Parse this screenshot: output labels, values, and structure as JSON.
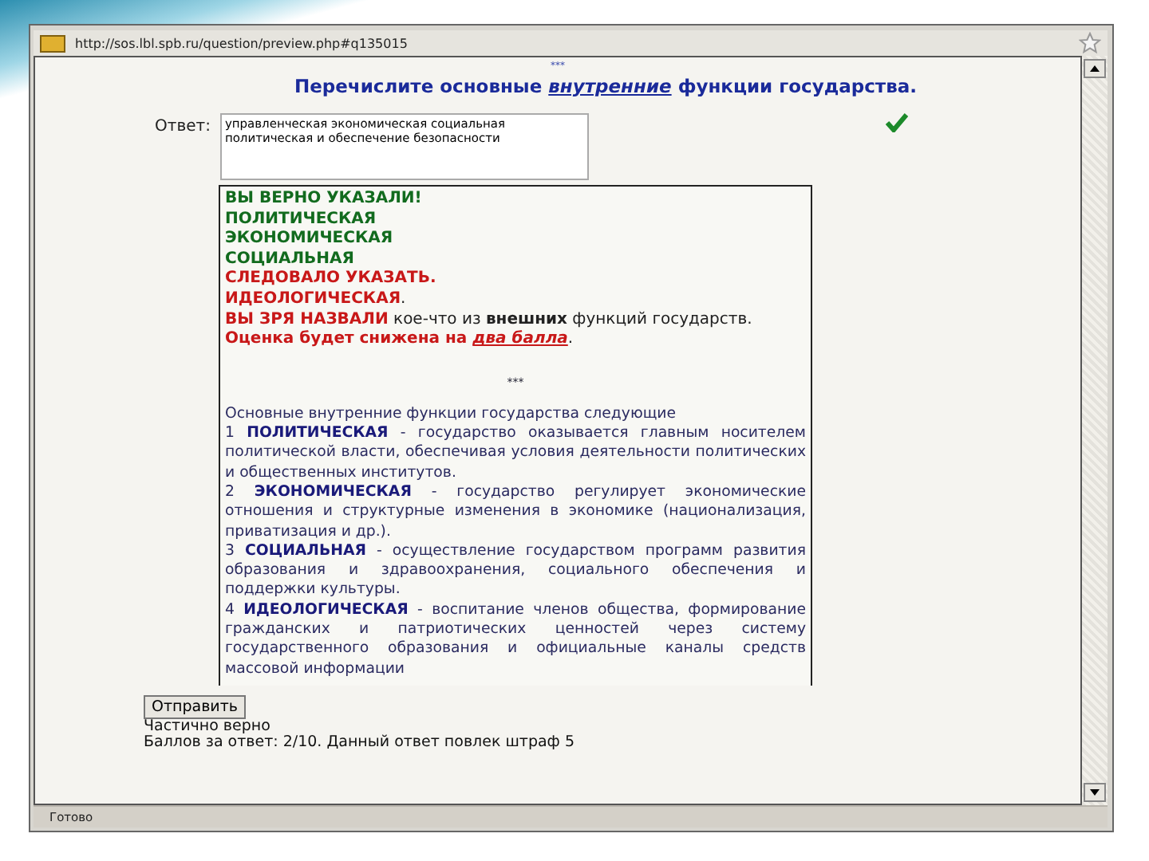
{
  "browser": {
    "address": "http://sos.lbl.spb.ru/question/preview.php#q135015",
    "status_bar": "Готово"
  },
  "question": {
    "mark": "***",
    "title_before": "Перечислите основные",
    "title_emphasis": "внутренние",
    "title_after": "функции государства."
  },
  "answer": {
    "label": "Ответ:",
    "value": "управленческая экономическая социальная\nполитическая и обеспечение безопасности",
    "correct": true
  },
  "feedback": {
    "lines": [
      {
        "segments": [
          {
            "text": "ВЫ ВЕРНО УКАЗАЛИ!",
            "color": "#126b1e",
            "bold": true
          }
        ]
      },
      {
        "segments": [
          {
            "text": "ПОЛИТИЧЕСКАЯ",
            "color": "#126b1e",
            "bold": true
          }
        ]
      },
      {
        "segments": [
          {
            "text": "ЭКОНОМИЧЕСКАЯ",
            "color": "#126b1e",
            "bold": true
          }
        ]
      },
      {
        "segments": [
          {
            "text": "СОЦИАЛЬНАЯ",
            "color": "#126b1e",
            "bold": true
          }
        ]
      },
      {
        "segments": [
          {
            "text": "СЛЕДОВАЛО УКАЗАТЬ.",
            "color": "#c81818",
            "bold": true
          }
        ]
      },
      {
        "segments": [
          {
            "text": "ИДЕОЛОГИЧЕСКАЯ",
            "color": "#c81818",
            "bold": true
          },
          {
            "text": ".",
            "bold": false
          }
        ]
      },
      {
        "segments": [
          {
            "text": "ВЫ ЗРЯ НАЗВАЛИ",
            "color": "#c81818",
            "bold": true
          },
          {
            "text": " кое-что из **внешних** функций государств.",
            "bold": false
          }
        ]
      },
      {
        "segments": [
          {
            "text": "Оценка будет снижена на ",
            "color": "#c81818",
            "bold": true
          },
          {
            "text": "*два балла*",
            "color": "#c81818",
            "bold": true,
            "underline": true
          },
          {
            "text": ".",
            "bold": false
          }
        ]
      }
    ],
    "mark": "***",
    "intro": "Основные внутренние функции государства следующие",
    "items": [
      {
        "number": "1",
        "term": "ПОЛИТИЧЕСКАЯ",
        "text": "- государство оказывается главным носителем политической власти, обеспечивая условия деятельности политических и общественных институтов."
      },
      {
        "number": "2",
        "term": "ЭКОНОМИЧЕСКАЯ",
        "text": "- государство регулирует экономические отношения и структурные изменения в экономике (национализация, приватизация и др.)."
      },
      {
        "number": "3",
        "term": "СОЦИАЛЬНАЯ",
        "text": "- осуществление государством программ развития образования и здравоохранения, социального обеспечения и поддержки культуры."
      },
      {
        "number": "4",
        "term": "ИДЕОЛОГИЧЕСКАЯ",
        "text": "- воспитание членов общества, формирование гражданских и патриотических ценностей через систему государственного образования и официальные каналы средств массовой информации"
      }
    ]
  },
  "submit_button": "Отправить",
  "result": {
    "verdict": "Частично верно",
    "score": "Баллов за ответ: 2/10. Данный ответ повлек штраф 5"
  }
}
